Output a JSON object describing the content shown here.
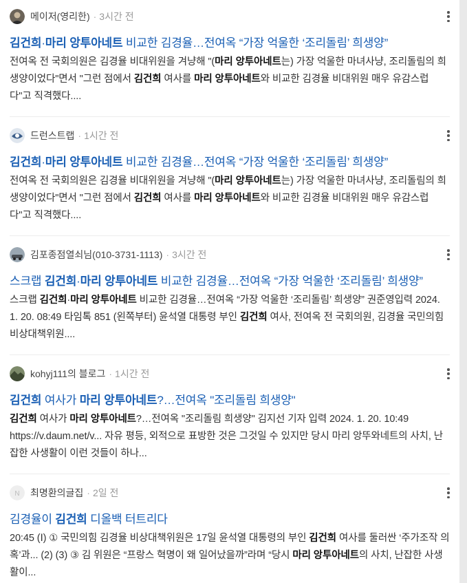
{
  "results": [
    {
      "author": "메이저(영리한)",
      "time": "3시간 전",
      "title_segments": [
        [
          "b",
          "김건희"
        ],
        [
          "t",
          "·"
        ],
        [
          "b",
          "마리 앙투아네트"
        ],
        [
          "t",
          " 비교한 김경율…전여옥 “가장 억울한 ‘조리돌림’ 희생양”"
        ]
      ],
      "snippet_segments": [
        [
          "t",
          "전여옥 전 국회의원은 김경율 비대위원을 겨냥해 \"("
        ],
        [
          "b",
          "마리 앙투아네트"
        ],
        [
          "t",
          "는) 가장 억울한 마녀사냥, 조리돌림의 희생양이었다\"면서 \"그런 점에서 "
        ],
        [
          "b",
          "김건희"
        ],
        [
          "t",
          " 여사를 "
        ],
        [
          "b",
          "마리 앙투아네트"
        ],
        [
          "t",
          "와 비교한 김경율 비대위원 매우 유감스럽다\"고 직격했다...."
        ]
      ]
    },
    {
      "author": "드런스트랩",
      "time": "1시간 전",
      "title_segments": [
        [
          "b",
          "김건희"
        ],
        [
          "t",
          "·"
        ],
        [
          "b",
          "마리 앙투아네트"
        ],
        [
          "t",
          " 비교한 김경율…전여옥 “가장 억울한 ‘조리돌림’ 희생양”"
        ]
      ],
      "snippet_segments": [
        [
          "t",
          "전여옥 전 국회의원은 김경율 비대위원을 겨냥해 \"("
        ],
        [
          "b",
          "마리 앙투아네트"
        ],
        [
          "t",
          "는) 가장 억울한 마녀사냥, 조리돌림의 희생양이었다\"면서 \"그런 점에서 "
        ],
        [
          "b",
          "김건희"
        ],
        [
          "t",
          " 여사를 "
        ],
        [
          "b",
          "마리 앙투아네트"
        ],
        [
          "t",
          "와 비교한 김경율 비대위원 매우 유감스럽다\"고 직격했다...."
        ]
      ]
    },
    {
      "author": "김포종점열쇠님(010-3731-1113)",
      "time": "3시간 전",
      "title_segments": [
        [
          "t",
          "스크랩 "
        ],
        [
          "b",
          "김건희"
        ],
        [
          "t",
          "·"
        ],
        [
          "b",
          "마리 앙투아네트"
        ],
        [
          "t",
          " 비교한 김경율…전여옥 “가장 억울한 ‘조리돌림’ 희생양”"
        ]
      ],
      "snippet_segments": [
        [
          "t",
          "스크랩 "
        ],
        [
          "b",
          "김건희"
        ],
        [
          "t",
          "·"
        ],
        [
          "b",
          "마리 앙투아네트"
        ],
        [
          "t",
          " 비교한 김경율…전여옥 “가장 억울한 ‘조리돌림’ 희생양” 권준영입력 2024. 1. 20. 08:49 타임톡 851 (왼쪽부터) 윤석열 대통령 부인 "
        ],
        [
          "b",
          "김건희"
        ],
        [
          "t",
          " 여사, 전여옥 전 국회의원, 김경율 국민의힘 비상대책위원...."
        ]
      ]
    },
    {
      "author": "kohyj111의 블로그",
      "time": "1시간 전",
      "title_segments": [
        [
          "b",
          "김건희"
        ],
        [
          "t",
          " 여사가 "
        ],
        [
          "b",
          "마리 앙투아네트"
        ],
        [
          "t",
          "?…전여옥 \"조리돌림 희생양\""
        ]
      ],
      "snippet_segments": [
        [
          "b",
          "김건희"
        ],
        [
          "t",
          " 여사가 "
        ],
        [
          "b",
          "마리 앙투아네트"
        ],
        [
          "t",
          "?…전여옥 \"조리돌림 희생양\" 김지선 기자 입력 2024. 1. 20. 10:49 https://v.daum.net/v... 자유 평등, 외적으로 표방한 것은 그것일 수 있지만 당시 마리 앙뚜와네트의 사치, 난잡한 사생활이 이런 것들이 하나..."
        ]
      ]
    },
    {
      "author": "최명환의글집",
      "time": "2일 전",
      "title_segments": [
        [
          "t",
          "김경율이 "
        ],
        [
          "b",
          "김건희"
        ],
        [
          "t",
          " 디올백 터트리다"
        ]
      ],
      "snippet_segments": [
        [
          "t",
          "20:45 (Ⅰ) ① 국민의힘 김경율 비상대책위원은 17일 윤석열 대통령의 부인 "
        ],
        [
          "b",
          "김건희"
        ],
        [
          "t",
          " 여사를 둘러싼 ‘주가조작 의혹’과... (2) (3) ③ 김 위원은 “프랑스 혁명이 왜 일어났을까”라며 “당시 "
        ],
        [
          "b",
          "마리 앙투아네트"
        ],
        [
          "t",
          "의 사치, 난잡한 사생활이..."
        ]
      ]
    }
  ],
  "avatars": [
    "photo-avatar",
    "blog-logo-avatar",
    "car-photo-avatar",
    "landscape-photo-avatar",
    "n-letter-avatar"
  ],
  "n_avatar_letter": "N",
  "colors": {
    "title_link": "#1a5fb4",
    "snippet_text": "#333333",
    "meta_time": "#999999",
    "divider": "#ececec",
    "scrollbar": "#e9e9e9"
  }
}
